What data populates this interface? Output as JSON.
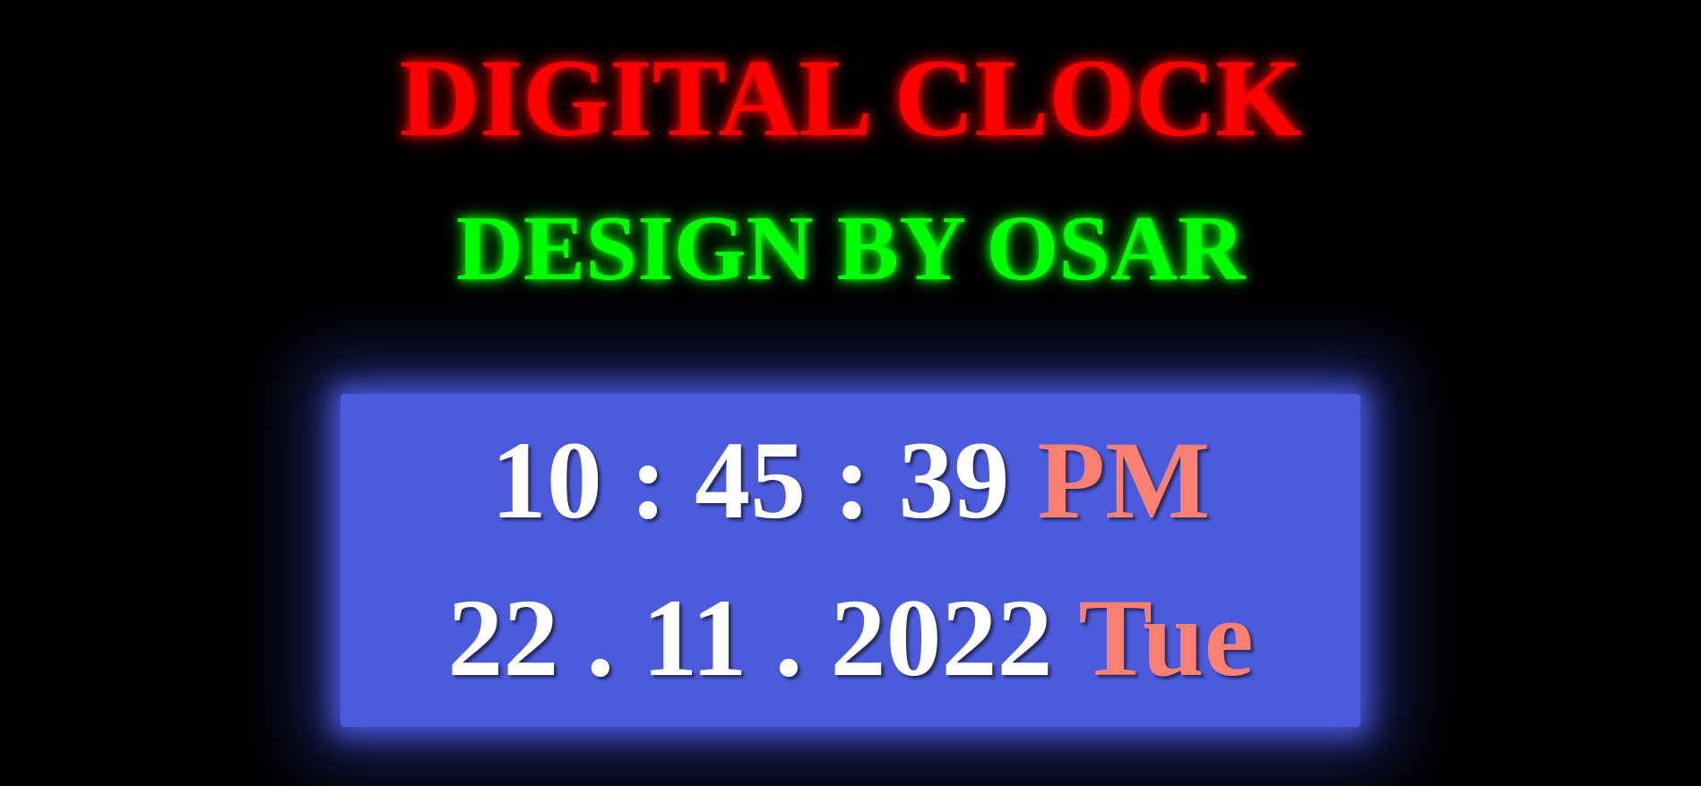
{
  "header": {
    "title": "DIGITAL CLOCK",
    "subtitle": "DESIGN BY OSAR"
  },
  "clock": {
    "hours": "10",
    "minutes": "45",
    "seconds": "39",
    "time_separator": ":",
    "meridiem": "PM",
    "day": "22",
    "month": "11",
    "year": "2022",
    "date_separator": ".",
    "weekday": "Tue"
  },
  "colors": {
    "background": "#000000",
    "title": "#ff0000",
    "subtitle": "#00ff00",
    "clock_panel": "#4b5bdc",
    "digits": "#ffffff",
    "accent": "#fa8072"
  }
}
